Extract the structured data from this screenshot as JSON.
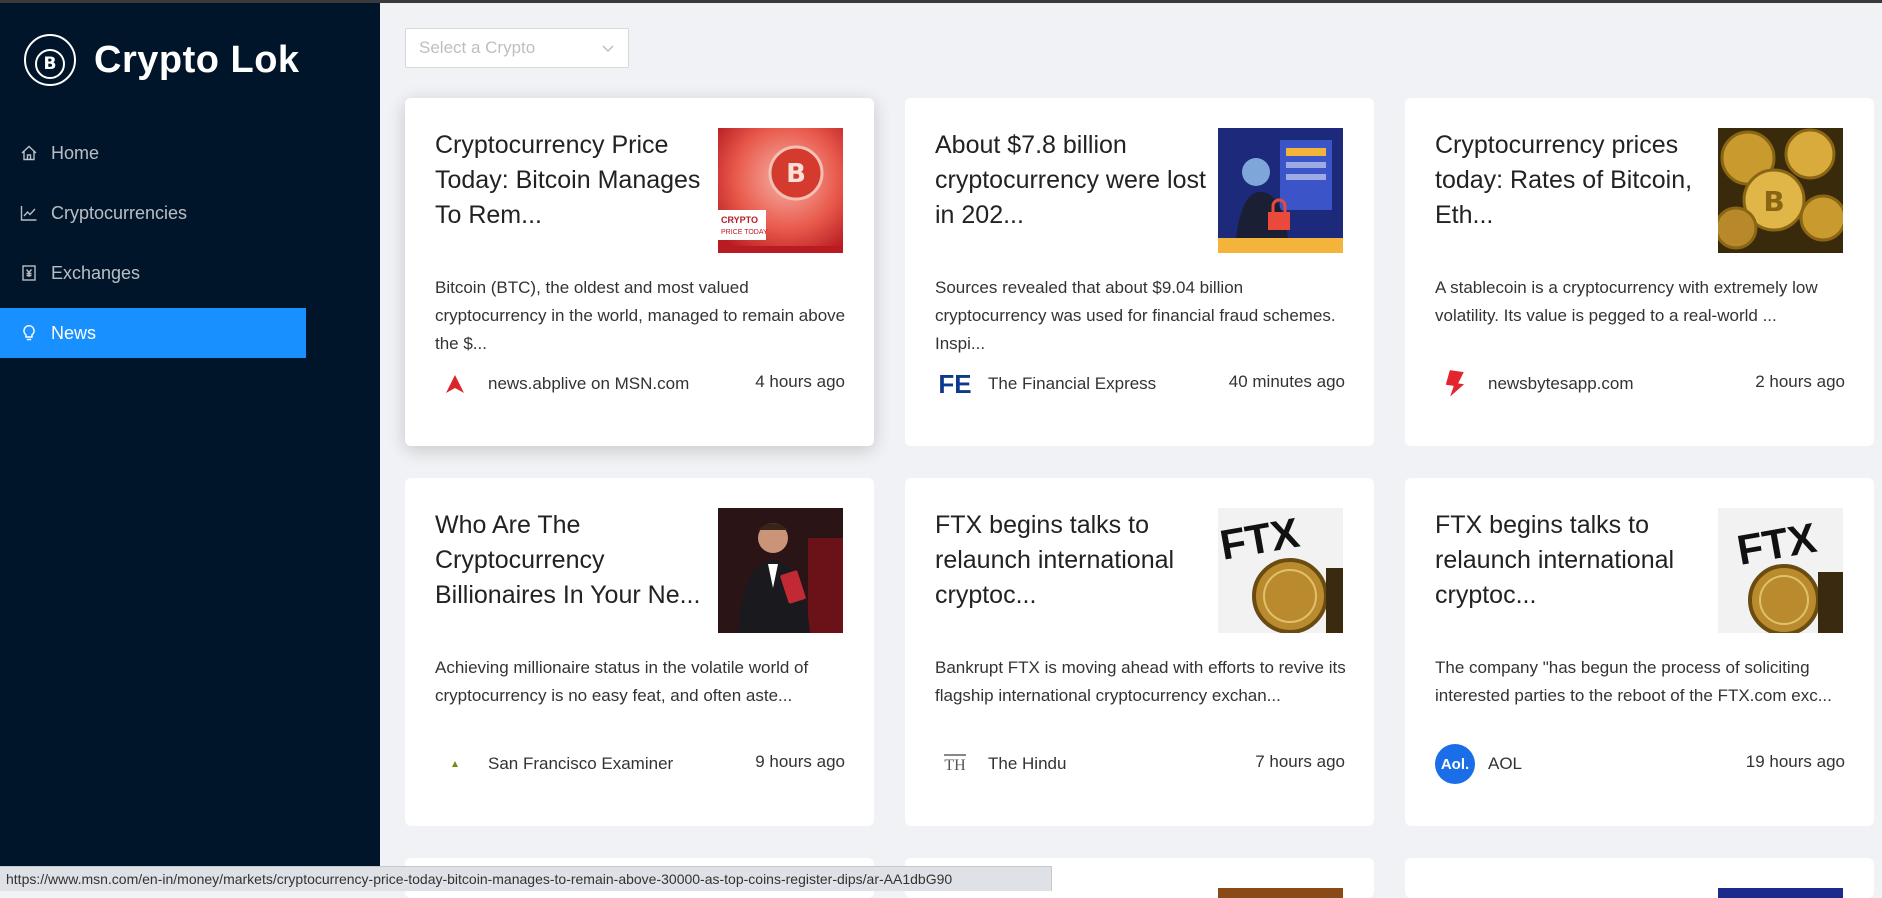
{
  "app": {
    "title": "Crypto Lok",
    "logo_letter": "B"
  },
  "sidebar": {
    "items": [
      {
        "label": "Home",
        "icon": "home-icon",
        "active": false
      },
      {
        "label": "Cryptocurrencies",
        "icon": "line-chart-icon",
        "active": false
      },
      {
        "label": "Exchanges",
        "icon": "money-collect-icon",
        "active": false
      },
      {
        "label": "News",
        "icon": "bulb-icon",
        "active": true
      }
    ]
  },
  "filter": {
    "placeholder": "Select a Crypto"
  },
  "news": [
    {
      "title": "Cryptocurrency Price Today: Bitcoin Manages To Rem...",
      "description": "Bitcoin (BTC), the oldest and most valued cryptocurrency in the world, managed to remain above the $...",
      "provider": "news.abplive on MSN.com",
      "time": "4 hours ago",
      "image_text": "CRYPTO PRICE TODAY",
      "image_icon": "bitcoin-image-icon",
      "provider_icon": "abp-logo-icon",
      "accent": "#d9262c"
    },
    {
      "title": "About $7.8 billion cryptocurrency were lost in 202...",
      "description": "Sources revealed that about $9.04 billion cryptocurrency was used for financial fraud schemes. Inspi...",
      "provider": "The Financial Express",
      "time": "40 minutes ago",
      "provider_mark": "FE",
      "image_icon": "hacker-image-icon",
      "provider_icon": "fe-logo-icon",
      "accent": "#0d3a8c"
    },
    {
      "title": "Cryptocurrency prices today: Rates of Bitcoin, Eth...",
      "description": "A stablecoin is a cryptocurrency with extremely low volatility. Its value is pegged to a real-world ...",
      "provider": "newsbytesapp.com",
      "time": "2 hours ago",
      "image_icon": "gold-coins-image-icon",
      "provider_icon": "newsbytes-logo-icon",
      "accent": "#e3262e"
    },
    {
      "title": "Who Are The Cryptocurrency Billionaires In Your Ne...",
      "description": "Achieving millionaire status in the volatile world of cryptocurrency is no easy feat, and often aste...",
      "provider": "San Francisco Examiner",
      "time": "9 hours ago",
      "image_icon": "businessman-image-icon",
      "provider_icon": "sf-examiner-logo-icon",
      "accent": "#7a8a12"
    },
    {
      "title": "FTX begins talks to relaunch international cryptoc...",
      "description": "Bankrupt FTX is moving ahead with efforts to revive its flagship international cryptocurrency exchan...",
      "provider": "The Hindu",
      "time": "7 hours ago",
      "image_text": "FTX",
      "provider_mark": "TH",
      "image_icon": "ftx-coin-image-icon",
      "provider_icon": "the-hindu-logo-icon",
      "accent": "#555555"
    },
    {
      "title": "FTX begins talks to relaunch international cryptoc...",
      "description": "The company \"has begun the process of soliciting interested parties to the reboot of the FTX.com exc...",
      "provider": "AOL",
      "time": "19 hours ago",
      "image_text": "FTX",
      "provider_mark": "Aol.",
      "image_icon": "ftx-coin-image-icon",
      "provider_icon": "aol-logo-icon",
      "accent": "#1a6fe8"
    }
  ],
  "statusbar": {
    "url": "https://www.msn.com/en-in/money/markets/cryptocurrency-price-today-bitcoin-manages-to-remain-above-30000-as-top-coins-register-dips/ar-AA1dbG90"
  }
}
